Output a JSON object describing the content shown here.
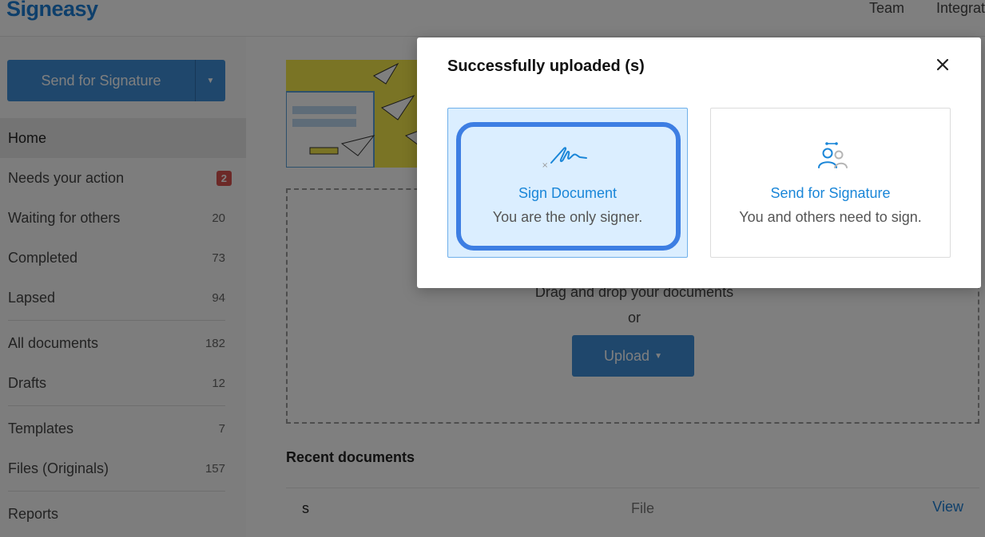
{
  "app": {
    "logo": "Signeasy",
    "topnav": [
      "Team",
      "Integrat"
    ]
  },
  "sidebar": {
    "send_button_label": "Send for Signature",
    "items": [
      {
        "label": "Home",
        "count": ""
      },
      {
        "label": "Needs your action",
        "badge": "2"
      },
      {
        "label": "Waiting for others",
        "count": "20"
      },
      {
        "label": "Completed",
        "count": "73"
      },
      {
        "label": "Lapsed",
        "count": "94"
      },
      {
        "label": "All documents",
        "count": "182"
      },
      {
        "label": "Drafts",
        "count": "12"
      },
      {
        "label": "Templates",
        "count": "7"
      },
      {
        "label": "Files (Originals)",
        "count": "157"
      },
      {
        "label": "Reports",
        "count": ""
      }
    ]
  },
  "main": {
    "drop_text": "Drag and drop your documents",
    "drop_or": "or",
    "upload_label": "Upload",
    "recent_title": "Recent documents",
    "recent_rows": [
      {
        "name": "s",
        "type": "File",
        "action": "View"
      }
    ]
  },
  "modal": {
    "title": "Successfully uploaded (s)",
    "options": [
      {
        "title": "Sign Document",
        "description": "You are the only signer."
      },
      {
        "title": "Send for Signature",
        "description": "You and others need to sign."
      }
    ]
  },
  "colors": {
    "accent": "#1a86d8",
    "button": "#3f8fd8",
    "badge": "#d9534f",
    "focus": "#3d7ee3",
    "selected_bg": "#dbeeff"
  }
}
